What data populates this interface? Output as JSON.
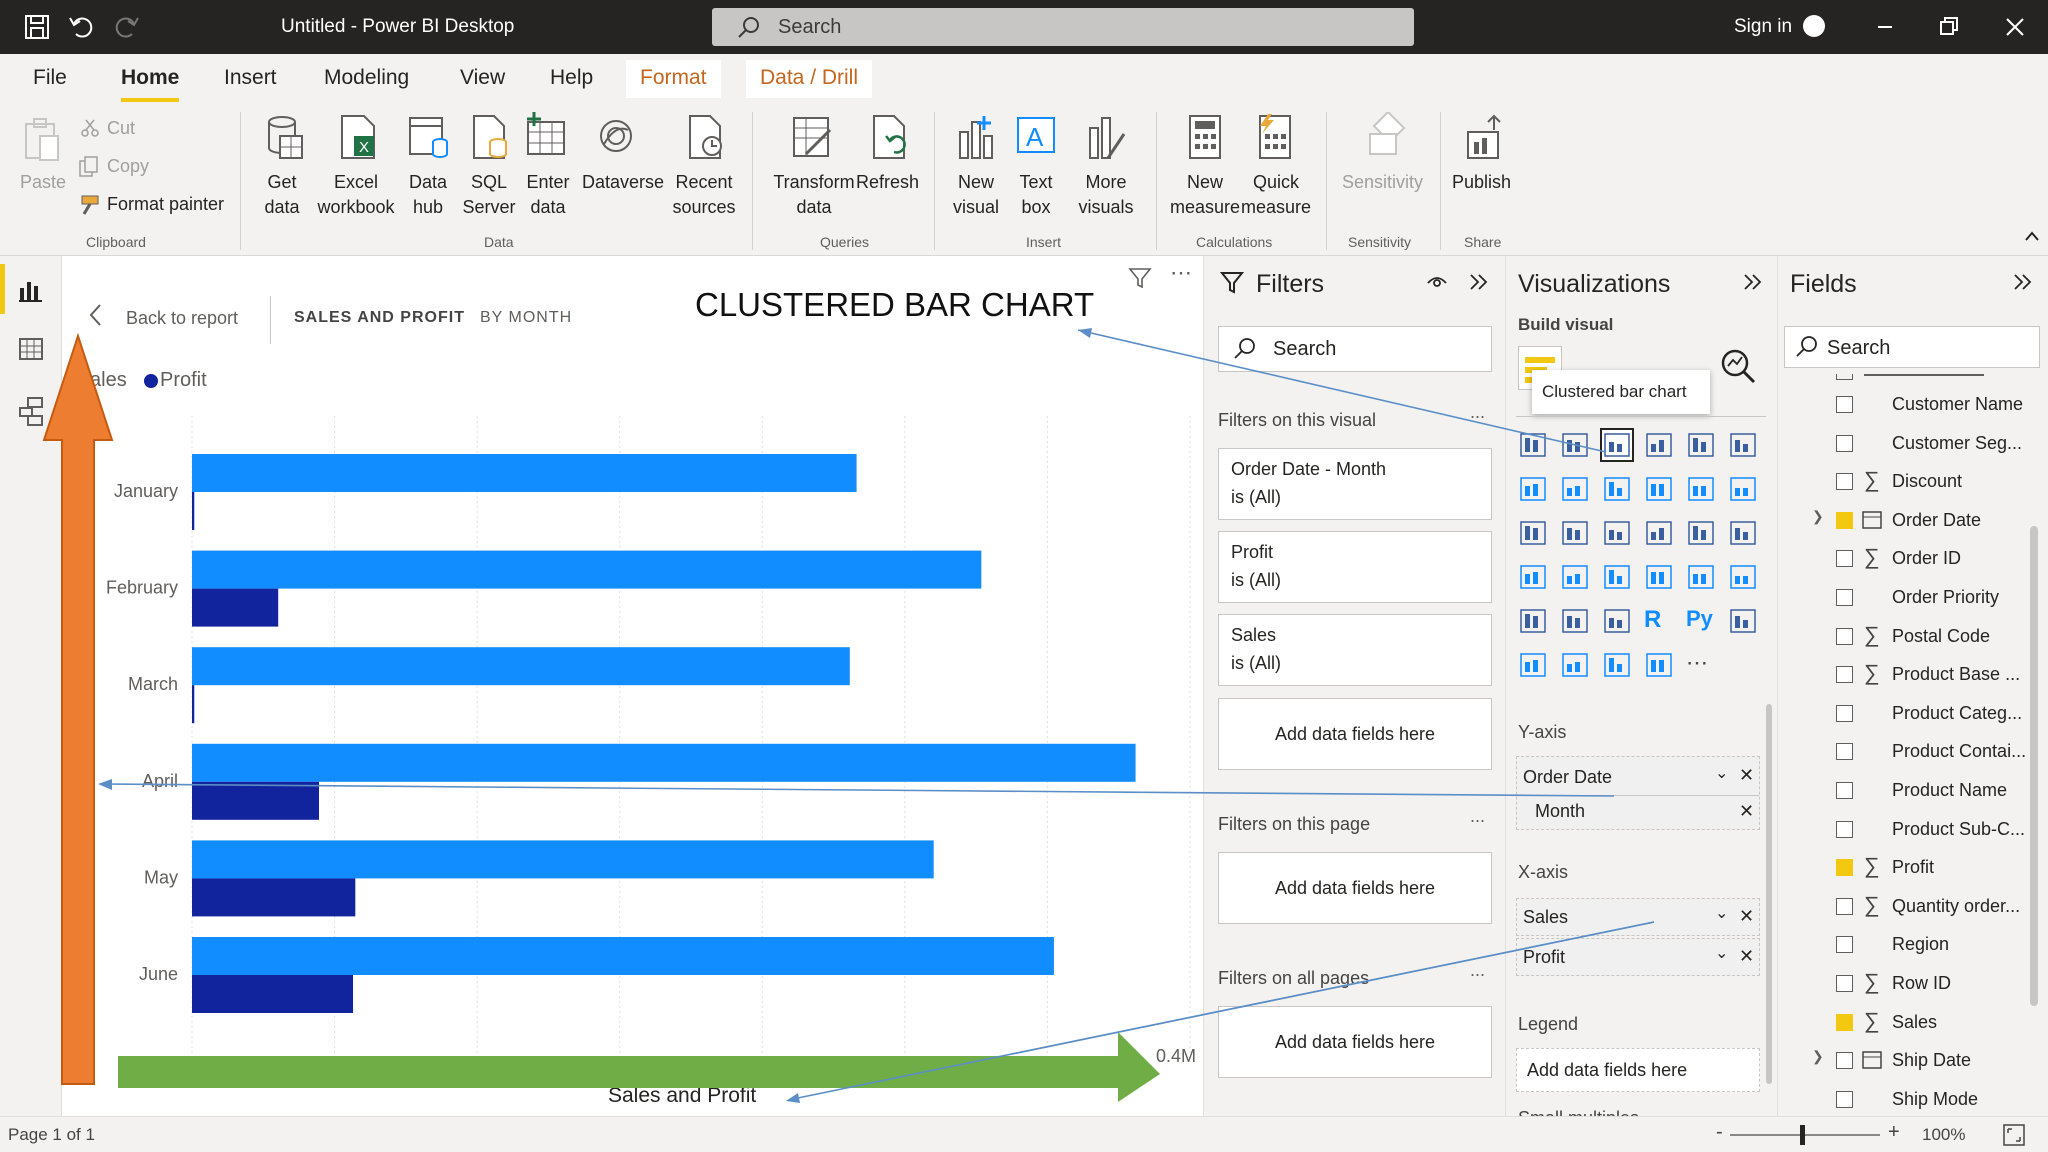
{
  "app": {
    "title": "Untitled - Power BI Desktop",
    "search_placeholder": "Search",
    "sign_in": "Sign in"
  },
  "tabs": [
    "File",
    "Home",
    "Insert",
    "Modeling",
    "View",
    "Help",
    "Format",
    "Data / Drill"
  ],
  "ribbon": {
    "paste": "Paste",
    "cut": "Cut",
    "copy": "Copy",
    "format_painter": "Format painter",
    "get_data": [
      "Get",
      "data"
    ],
    "excel": [
      "Excel",
      "workbook"
    ],
    "data_hub": [
      "Data",
      "hub"
    ],
    "sql": [
      "SQL",
      "Server"
    ],
    "enter_data": [
      "Enter",
      "data"
    ],
    "dataverse": "Dataverse",
    "recent": [
      "Recent",
      "sources"
    ],
    "transform": [
      "Transform",
      "data"
    ],
    "refresh": "Refresh",
    "new_visual": [
      "New",
      "visual"
    ],
    "text_box": [
      "Text",
      "box"
    ],
    "more_visuals": [
      "More",
      "visuals"
    ],
    "new_measure": [
      "New",
      "measure"
    ],
    "quick_measure": [
      "Quick",
      "measure"
    ],
    "sensitivity": "Sensitivity",
    "publish": "Publish",
    "groups": {
      "clipboard": "Clipboard",
      "data": "Data",
      "queries": "Queries",
      "insert": "Insert",
      "calculations": "Calculations",
      "sensitivity": "Sensitivity",
      "share": "Share"
    }
  },
  "canvas": {
    "back": "Back to report",
    "tab1": "SALES AND PROFIT",
    "tab2": "BY MONTH",
    "annotation": "CLUSTERED BAR CHART",
    "legend_sales": "ales",
    "legend_profit": "Profit",
    "xaxis_label": "Sales and Profit",
    "xaxis_tick": "0.4M"
  },
  "chart_data": {
    "type": "bar",
    "orientation": "horizontal",
    "categories": [
      "January",
      "February",
      "March",
      "April",
      "May",
      "June"
    ],
    "series": [
      {
        "name": "Sales",
        "color": "#118dff",
        "values": [
          0.293,
          0.348,
          0.29,
          0.416,
          0.327,
          0.38
        ]
      },
      {
        "name": "Profit",
        "color": "#12239e",
        "values": [
          0.001,
          0.038,
          0.001,
          0.056,
          0.072,
          0.071
        ]
      }
    ],
    "xlim": [
      0,
      0.44
    ],
    "xlabel": "Sales and Profit",
    "ylabel": "",
    "x_tick_labels": [
      "0.4M"
    ]
  },
  "filters": {
    "title": "Filters",
    "search": "Search",
    "on_visual": "Filters on this visual",
    "cards": [
      {
        "name": "Order Date - Month",
        "state": "is (All)"
      },
      {
        "name": "Profit",
        "state": "is (All)"
      },
      {
        "name": "Sales",
        "state": "is (All)"
      }
    ],
    "add": "Add data fields here",
    "on_page": "Filters on this page",
    "on_all": "Filters on all pages",
    "more": "..."
  },
  "viz": {
    "title": "Visualizations",
    "build": "Build visual",
    "tooltip": "Clustered bar chart",
    "yaxis": "Y-axis",
    "y_field": "Order Date",
    "y_sub": "Month",
    "xaxis": "X-axis",
    "x_fields": [
      "Sales",
      "Profit"
    ],
    "legend": "Legend",
    "add": "Add data fields here",
    "small_multiples": "Small multiples"
  },
  "fields": {
    "title": "Fields",
    "search": "Search",
    "items": [
      {
        "name": "Customer Name",
        "checked": false,
        "sigma": false
      },
      {
        "name": "Customer Seg...",
        "checked": false,
        "sigma": false
      },
      {
        "name": "Discount",
        "checked": false,
        "sigma": true
      },
      {
        "name": "Order Date",
        "checked": true,
        "sigma": false,
        "date": true
      },
      {
        "name": "Order ID",
        "checked": false,
        "sigma": true
      },
      {
        "name": "Order Priority",
        "checked": false,
        "sigma": false
      },
      {
        "name": "Postal Code",
        "checked": false,
        "sigma": true
      },
      {
        "name": "Product Base ...",
        "checked": false,
        "sigma": true
      },
      {
        "name": "Product Categ...",
        "checked": false,
        "sigma": false
      },
      {
        "name": "Product Contai...",
        "checked": false,
        "sigma": false
      },
      {
        "name": "Product Name",
        "checked": false,
        "sigma": false
      },
      {
        "name": "Product Sub-C...",
        "checked": false,
        "sigma": false
      },
      {
        "name": "Profit",
        "checked": true,
        "sigma": true
      },
      {
        "name": "Quantity order...",
        "checked": false,
        "sigma": true
      },
      {
        "name": "Region",
        "checked": false,
        "sigma": false
      },
      {
        "name": "Row ID",
        "checked": false,
        "sigma": true
      },
      {
        "name": "Sales",
        "checked": true,
        "sigma": true
      },
      {
        "name": "Ship Date",
        "checked": false,
        "sigma": false,
        "date": true
      },
      {
        "name": "Ship Mode",
        "checked": false,
        "sigma": false
      }
    ]
  },
  "status": {
    "page": "Page 1 of 1",
    "zoom": "100%"
  }
}
